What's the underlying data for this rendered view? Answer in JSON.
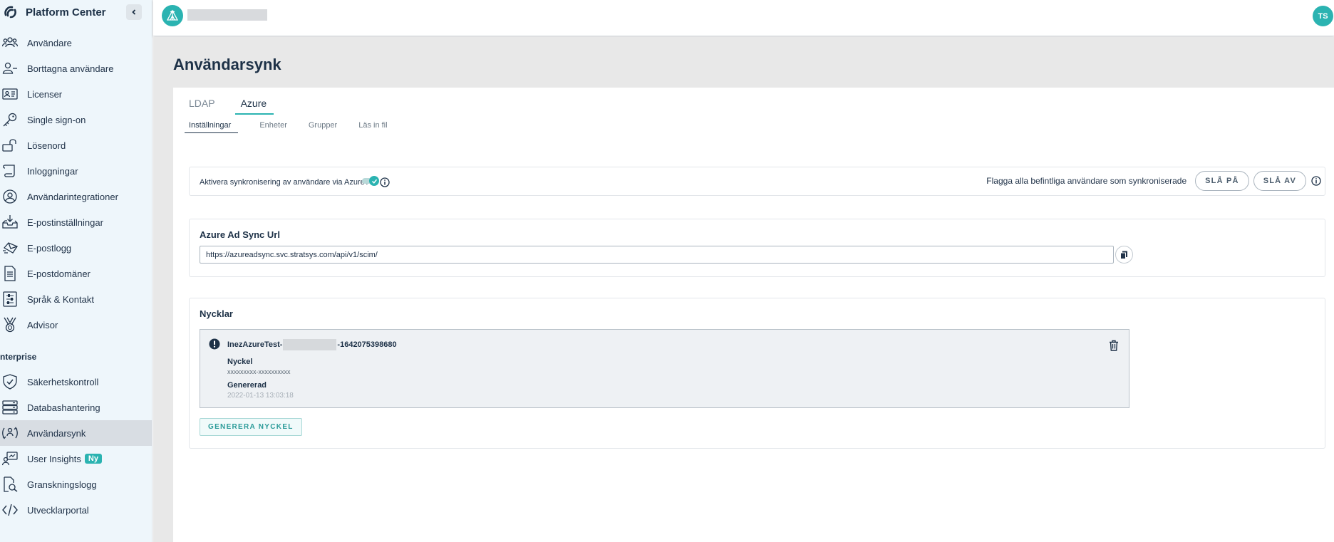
{
  "app": {
    "title": "Platform Center"
  },
  "sidebar": {
    "items": [
      {
        "label": "Användare",
        "icon": "users-icon"
      },
      {
        "label": "Borttagna användare",
        "icon": "user-minus-icon"
      },
      {
        "label": "Licenser",
        "icon": "id-card-icon"
      },
      {
        "label": "Single sign-on",
        "icon": "key-icon"
      },
      {
        "label": "Lösenord",
        "icon": "unlock-icon"
      },
      {
        "label": "Inloggningar",
        "icon": "scroll-icon"
      },
      {
        "label": "Användarintegrationer",
        "icon": "user-circle-icon"
      },
      {
        "label": "E-postinställningar",
        "icon": "inbox-download-icon"
      },
      {
        "label": "E-postlogg",
        "icon": "mail-fly-icon"
      },
      {
        "label": "E-postdomäner",
        "icon": "document-icon"
      },
      {
        "label": "Språk & Kontakt",
        "icon": "sliders-icon"
      },
      {
        "label": "Advisor",
        "icon": "medal-icon"
      }
    ],
    "enterprise_heading": "nterprise",
    "enterprise_items": [
      {
        "label": "Säkerhetskontroll",
        "icon": "shield-check-icon"
      },
      {
        "label": "Databashantering",
        "icon": "database-icon"
      },
      {
        "label": "Användarsynk",
        "icon": "user-sync-icon",
        "active": true
      },
      {
        "label": "User Insights",
        "icon": "insights-icon",
        "badge": "Ny"
      },
      {
        "label": "Granskningslogg",
        "icon": "file-search-icon"
      },
      {
        "label": "Utvecklarportal",
        "icon": "code-icon"
      }
    ]
  },
  "topbar": {
    "user_initials": "TS"
  },
  "main": {
    "page_title": "Användarsynk",
    "tabs": [
      {
        "label": "LDAP"
      },
      {
        "label": "Azure",
        "active": true
      }
    ],
    "subtabs": [
      {
        "label": "Inställningar",
        "active": true
      },
      {
        "label": "Enheter"
      },
      {
        "label": "Grupper"
      },
      {
        "label": "Läs in fil"
      }
    ],
    "sync": {
      "toggle_label": "Aktivera synkronisering av användare via Azure AD",
      "toggle_on": true,
      "flag_label": "Flagga alla befintliga användare som synkroniserade",
      "on_button": "SLÅ PÅ",
      "off_button": "SLÅ AV"
    },
    "url_panel": {
      "title": "Azure Ad Sync Url",
      "url": "https://azureadsync.svc.stratsys.com/api/v1/scim/"
    },
    "keys_panel": {
      "title": "Nycklar",
      "key": {
        "name_prefix": "InezAzureTest-",
        "name_suffix": "-1642075398680",
        "key_label": "Nyckel",
        "key_value": "xxxxxxxxx-xxxxxxxxxx",
        "generated_label": "Genererad",
        "generated_value": "2022-01-13 13:03:18"
      },
      "generate_button": "GENERERA NYCKEL"
    }
  },
  "colors": {
    "accent": "#2bb3b1",
    "text": "#1d3147",
    "sidebar_bg": "#eef6fb"
  }
}
